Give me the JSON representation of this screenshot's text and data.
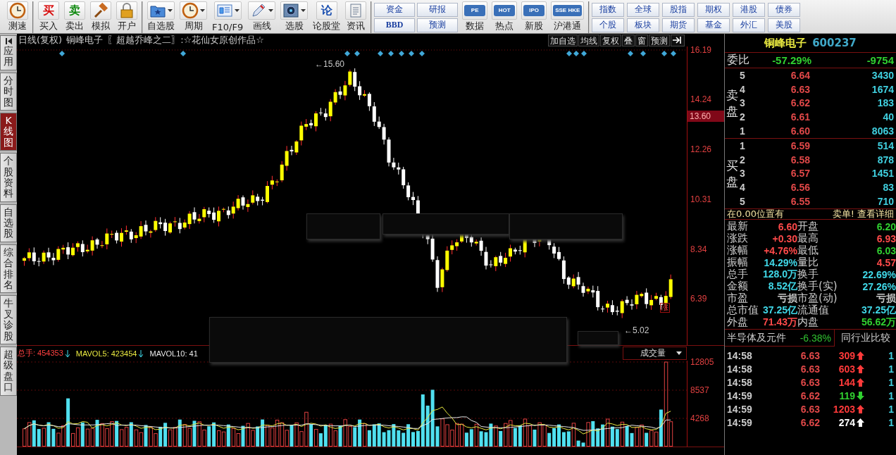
{
  "toolbar": {
    "groups": [
      [
        {
          "label": "测速",
          "kind": "clock",
          "menu": false
        }
      ],
      [
        {
          "label": "买入",
          "kind": "char",
          "glyph": "买",
          "color": "#d81010",
          "menu": false
        },
        {
          "label": "卖出",
          "kind": "char",
          "glyph": "卖",
          "color": "#108a10",
          "menu": false
        },
        {
          "label": "模拟",
          "kind": "gavel",
          "menu": false
        },
        {
          "label": "开户",
          "kind": "lock",
          "menu": false
        }
      ],
      [
        {
          "label": "自选股",
          "kind": "folder",
          "menu": true
        },
        {
          "label": "周期",
          "kind": "clock",
          "menu": true
        },
        {
          "label": "F10/F9",
          "kind": "doc",
          "menu": true
        },
        {
          "label": "画线",
          "kind": "pencil",
          "menu": true
        },
        {
          "label": "选股",
          "kind": "radar",
          "menu": true
        },
        {
          "label": "论股堂",
          "kind": "char",
          "glyph": "论",
          "color": "#1a4fb0",
          "menu": false
        },
        {
          "label": "资讯",
          "kind": "page",
          "menu": false
        }
      ]
    ],
    "small_buttons": [
      [
        "资金",
        "BBD"
      ],
      [
        "研报",
        "预测"
      ]
    ],
    "apps": [
      {
        "label": "数据",
        "glyph": "PE"
      },
      {
        "label": "热点",
        "glyph": "HOT"
      },
      {
        "label": "新股",
        "glyph": "IPO"
      },
      {
        "label": "沪港通",
        "glyph": "SSE HKE"
      }
    ],
    "markets": [
      [
        "指数",
        "全球",
        "股指",
        "期权",
        "港股",
        "债券"
      ],
      [
        "个股",
        "板块",
        "期货",
        "基金",
        "外汇",
        "美股"
      ]
    ]
  },
  "side_tabs": [
    {
      "label": "应用",
      "selected": false,
      "kind": "collapse"
    },
    {
      "label": "分时图",
      "selected": false,
      "kind": "plain"
    },
    {
      "label": "K线图",
      "selected": true,
      "kind": "plain"
    },
    {
      "label": "个股资料",
      "selected": false,
      "kind": "plain"
    },
    {
      "label": "自选股",
      "selected": false,
      "kind": "plain"
    },
    {
      "label": "综合排名",
      "selected": false,
      "kind": "plain"
    },
    {
      "label": "牛叉诊股",
      "selected": false,
      "kind": "plain"
    },
    {
      "label": "超级盘口",
      "selected": false,
      "kind": "plain"
    }
  ],
  "chart": {
    "period": "日线(复权)",
    "stock": "铜峰电子",
    "formula": "〖超越乔峰之二〗:☆花仙女原创作品☆",
    "header_buttons": [
      "加自选",
      "均线",
      "复权",
      "叠",
      "窗",
      "预测"
    ],
    "price_axis": [
      {
        "label": "16.19",
        "kind": "tick"
      },
      {
        "label": "14.24",
        "kind": "tick"
      },
      {
        "label": "13.60",
        "kind": "current"
      },
      {
        "label": "12.26",
        "kind": "tick"
      },
      {
        "label": "10.31",
        "kind": "tick"
      },
      {
        "label": "8.34",
        "kind": "tick"
      },
      {
        "label": "6.39",
        "kind": "tick"
      }
    ],
    "peak_label": "←15.60",
    "low_label": "←5.02",
    "rise_badge": "涨",
    "volume_legend": [
      {
        "name": "总手: 454353",
        "kind": "down",
        "color": "#ff4040"
      },
      {
        "name": "MAVOL5: 423454",
        "kind": "down",
        "color": "#e8e840"
      },
      {
        "name": "MAVOL10: 41",
        "kind": "plain",
        "color": "#e8e8e8"
      }
    ],
    "indicator": "成交量",
    "volume_axis": [
      "12805",
      "8537",
      "4268"
    ]
  },
  "quote": {
    "name": "铜峰电子",
    "code": "600237",
    "ratio": {
      "label": "委比",
      "percent": "-57.29%",
      "diff": "-9754"
    },
    "sell_label": "卖盘",
    "buy_label": "买盘",
    "sell": [
      {
        "level": "5",
        "price": "6.64",
        "volume": "3430"
      },
      {
        "level": "4",
        "price": "6.63",
        "volume": "1674"
      },
      {
        "level": "3",
        "price": "6.62",
        "volume": "183"
      },
      {
        "level": "2",
        "price": "6.61",
        "volume": "40"
      },
      {
        "level": "1",
        "price": "6.60",
        "volume": "8063"
      }
    ],
    "buy": [
      {
        "level": "1",
        "price": "6.59",
        "volume": "514"
      },
      {
        "level": "2",
        "price": "6.58",
        "volume": "878"
      },
      {
        "level": "3",
        "price": "6.57",
        "volume": "1451"
      },
      {
        "level": "4",
        "price": "6.56",
        "volume": "83"
      },
      {
        "level": "5",
        "price": "6.55",
        "volume": "710"
      }
    ],
    "notice": "在0.00位置有",
    "notice_link": "卖单! 查看详细",
    "stats": [
      {
        "label": "最新",
        "value": "6.60",
        "color": "#ff4a4a"
      },
      {
        "label": "开盘",
        "value": "6.20",
        "color": "#30d030"
      },
      {
        "label": "涨跌",
        "value": "+0.30",
        "color": "#ff4a4a"
      },
      {
        "label": "最高",
        "value": "6.93",
        "color": "#ff4a4a"
      },
      {
        "label": "涨幅",
        "value": "+4.76%",
        "color": "#ff4a4a"
      },
      {
        "label": "最低",
        "value": "6.03",
        "color": "#30d030"
      },
      {
        "label": "振幅",
        "value": "14.29%",
        "color": "#40d8e8"
      },
      {
        "label": "量比",
        "value": "4.57",
        "color": "#ff4a4a"
      },
      {
        "label": "总手",
        "value": "128.0万",
        "color": "#40d8e8"
      },
      {
        "label": "换手",
        "value": "22.69%",
        "color": "#40d8e8"
      },
      {
        "label": "金额",
        "value": "8.52亿",
        "color": "#40d8e8"
      },
      {
        "label": "换手(实)",
        "value": "27.26%",
        "color": "#40d8e8"
      },
      {
        "label": "市盈",
        "value": "亏损",
        "color": "#c8c8c8"
      },
      {
        "label": "市盈(动)",
        "value": "亏损",
        "color": "#c8c8c8"
      },
      {
        "label": "总市值",
        "value": "37.25亿",
        "color": "#40d8e8"
      },
      {
        "label": "流通值",
        "value": "37.25亿",
        "color": "#40d8e8"
      },
      {
        "label": "外盘",
        "value": "71.43万",
        "color": "#ff4a4a"
      },
      {
        "label": "内盘",
        "value": "56.62万",
        "color": "#30d030"
      }
    ],
    "industry": {
      "name": "半导体及元件",
      "change": "-6.38%",
      "button": "同行业比较"
    },
    "ticks": [
      {
        "time": "14:58",
        "price": "6.63",
        "volume": "309",
        "kind": "up",
        "column_5": "1"
      },
      {
        "time": "14:58",
        "price": "6.63",
        "volume": "603",
        "kind": "up",
        "column_5": "1"
      },
      {
        "time": "14:58",
        "price": "6.63",
        "volume": "144",
        "kind": "up",
        "column_5": "1"
      },
      {
        "time": "14:59",
        "price": "6.62",
        "volume": "119",
        "kind": "down",
        "column_5": "1"
      },
      {
        "time": "14:59",
        "price": "6.63",
        "volume": "1203",
        "kind": "up",
        "column_5": "1"
      },
      {
        "time": "14:59",
        "price": "6.62",
        "volume": "274",
        "kind": "neutral",
        "column_5": "1"
      }
    ]
  }
}
